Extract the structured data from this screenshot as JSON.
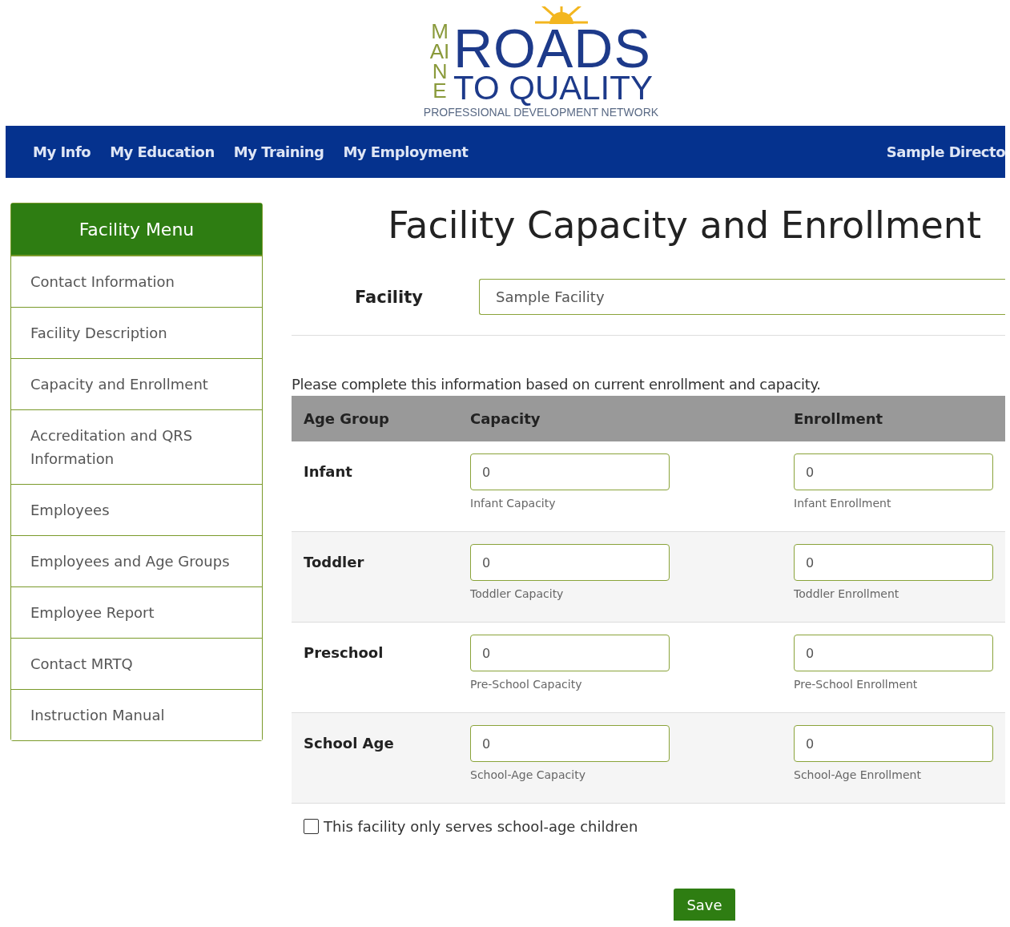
{
  "logo": {
    "side_word": "MAINE",
    "main_word": "ROADS",
    "second_line": "TO QUALITY",
    "tagline": "PROFESSIONAL DEVELOPMENT NETWORK"
  },
  "nav": {
    "items": [
      "My Info",
      "My Education",
      "My Training",
      "My Employment"
    ],
    "user": "Sample Directo"
  },
  "sidebar": {
    "title": "Facility Menu",
    "items": [
      {
        "label": "Contact Information",
        "selected": false
      },
      {
        "label": "Facility Description",
        "selected": false
      },
      {
        "label": "Capacity and Enrollment",
        "selected": false
      },
      {
        "label": "Accreditation and QRS Information",
        "selected": false
      },
      {
        "label": "Employees",
        "selected": false
      },
      {
        "label": "Employees and Age Groups",
        "selected": false
      },
      {
        "label": "Employee Report",
        "selected": false
      },
      {
        "label": "Contact MRTQ",
        "selected": false
      },
      {
        "label": "Instruction Manual",
        "selected": false
      }
    ]
  },
  "page_title": "Facility Capacity and Enrollment",
  "facility": {
    "label": "Facility",
    "value": "Sample Facility"
  },
  "instructions": "Please complete this information based on current enrollment and capacity.",
  "table": {
    "columns": [
      "Age Group",
      "Capacity",
      "Enrollment"
    ],
    "rows": [
      {
        "group": "Infant",
        "capacity": "0",
        "capacity_hint": "Infant Capacity",
        "enrollment": "0",
        "enrollment_hint": "Infant Enrollment"
      },
      {
        "group": "Toddler",
        "capacity": "0",
        "capacity_hint": "Toddler Capacity",
        "enrollment": "0",
        "enrollment_hint": "Toddler Enrollment"
      },
      {
        "group": "Preschool",
        "capacity": "0",
        "capacity_hint": "Pre-School Capacity",
        "enrollment": "0",
        "enrollment_hint": "Pre-School Enrollment"
      },
      {
        "group": "School Age",
        "capacity": "0",
        "capacity_hint": "School-Age Capacity",
        "enrollment": "0",
        "enrollment_hint": "School-Age Enrollment"
      }
    ]
  },
  "school_age_only": {
    "label": "This facility only serves school-age children",
    "checked": false
  },
  "save_button": "Save"
}
